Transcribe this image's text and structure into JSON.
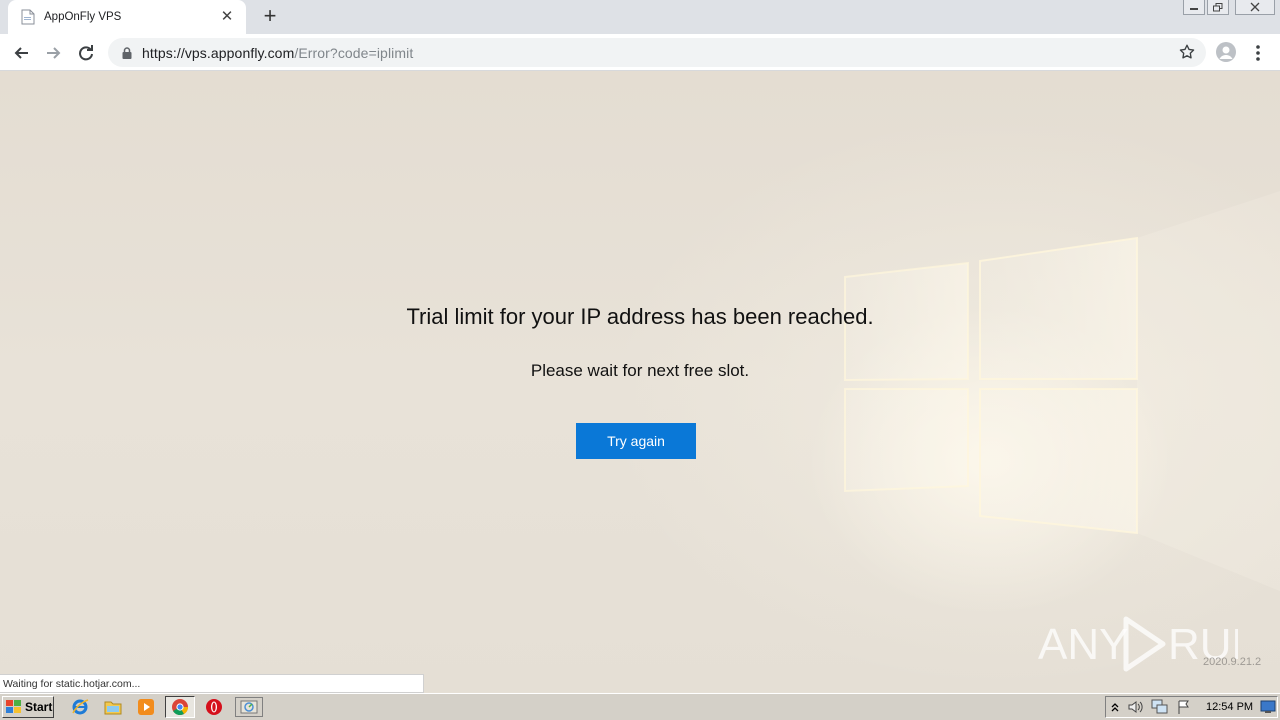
{
  "browser": {
    "tab_title": "AppOnFly VPS",
    "url_host": "https://vps.apponfly.com",
    "url_path": "/Error?code=iplimit"
  },
  "page": {
    "heading": "Trial limit for your IP address has been reached.",
    "subheading": "Please wait for next free slot.",
    "try_again_label": "Try again"
  },
  "watermark": {
    "brand": "ANY RUN",
    "version": "2020.9.21.2"
  },
  "status_bar": {
    "text": "Waiting for static.hotjar.com..."
  },
  "taskbar": {
    "start_label": "Start",
    "clock": "12:54 PM",
    "pinned": [
      "ie-icon",
      "explorer-icon",
      "media-player-icon",
      "chrome-icon",
      "opera-icon",
      "task-icon"
    ]
  },
  "colors": {
    "accent_button": "#0a78d7",
    "background": "#e6e0d6"
  }
}
